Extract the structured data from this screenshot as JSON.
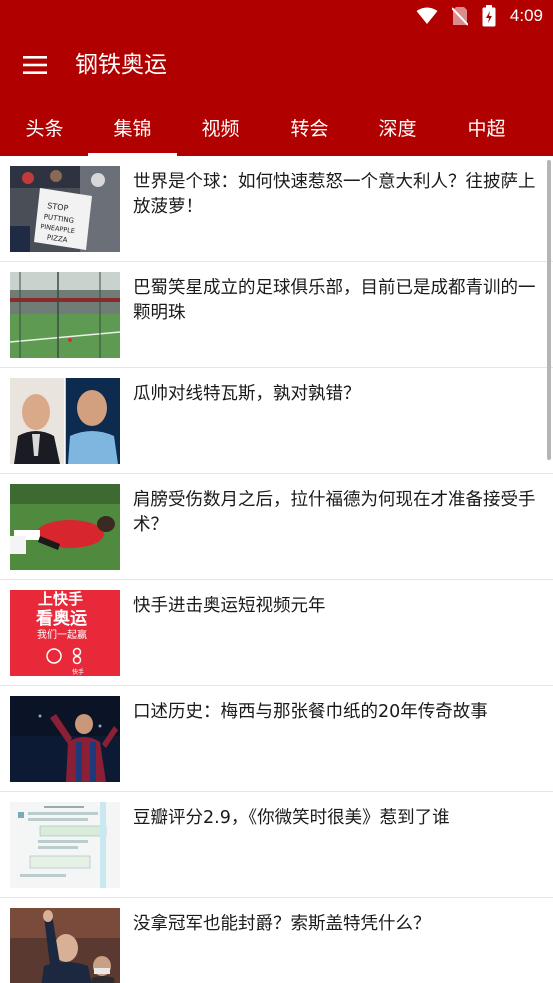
{
  "status_bar": {
    "time": "4:09",
    "icons": [
      "wifi-icon",
      "no-sim-icon",
      "battery-charging-icon"
    ]
  },
  "app_bar": {
    "title": "钢铁奥运",
    "menu_icon": "hamburger-menu-icon"
  },
  "tabs": [
    {
      "label": "头条"
    },
    {
      "label": "集锦"
    },
    {
      "label": "视频"
    },
    {
      "label": "转会"
    },
    {
      "label": "深度"
    },
    {
      "label": "中超"
    }
  ],
  "selected_tab": "集锦",
  "colors": {
    "primary": "#b00000",
    "text": "#1a1a1a",
    "divider": "#e6e6e6"
  },
  "articles": [
    {
      "title": "世界是个球：如何快速惹怒一个意大利人？往披萨上放菠萝！",
      "thumbnail": "stop-putting-pineapple-on-pizza-sign",
      "thumb_text": "STOP PUTTING PINEAPPLE ON PIZZA"
    },
    {
      "title": "巴蜀笑星成立的足球俱乐部，目前已是成都青训的一颗明珠",
      "thumbnail": "football-pitch-photo"
    },
    {
      "title": "瓜帅对线特瓦斯，孰对孰错？",
      "thumbnail": "two-men-portrait-photo"
    },
    {
      "title": "肩膀受伤数月之后，拉什福德为何现在才准备接受手术？",
      "thumbnail": "injured-player-on-grass-photo"
    },
    {
      "title": "快手进击奥运短视频元年",
      "thumbnail": "kuaishou-olympics-poster",
      "poster_lines": [
        "上快手",
        "看奥运",
        "我们一起赢"
      ],
      "poster_brand": "快手"
    },
    {
      "title": "口述历史：梅西与那张餐巾纸的20年传奇故事",
      "thumbnail": "messi-celebration-photo"
    },
    {
      "title": "豆瓣评分2.9，《你微笑时很美》惹到了谁",
      "thumbnail": "chat-screenshot-image"
    },
    {
      "title": "没拿冠军也能封爵？索斯盖特凭什么？",
      "thumbnail": "southgate-waving-photo"
    }
  ]
}
